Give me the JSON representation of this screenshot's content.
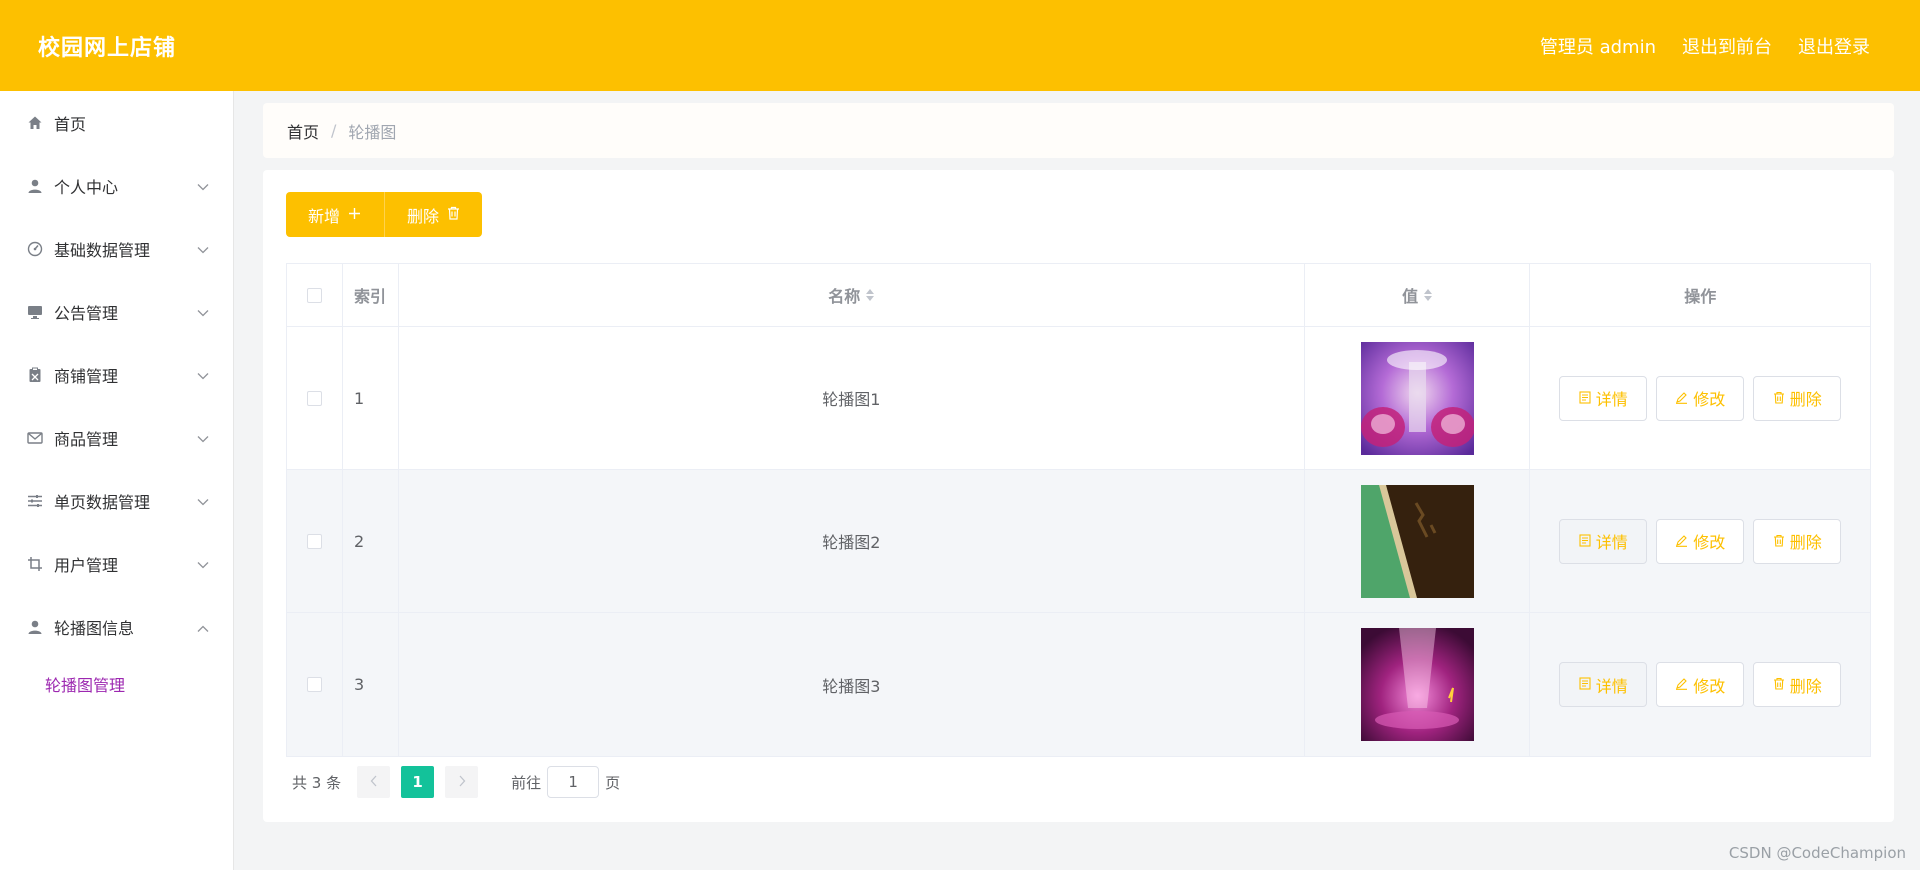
{
  "header": {
    "app_title": "校园网上店铺",
    "admin_label": "管理员 admin",
    "exit_front": "退出到前台",
    "logout": "退出登录"
  },
  "sidebar": {
    "items": [
      {
        "label": "首页",
        "icon": "home-icon",
        "expandable": false
      },
      {
        "label": "个人中心",
        "icon": "user-icon",
        "expandable": true
      },
      {
        "label": "基础数据管理",
        "icon": "gauge-icon",
        "expandable": true
      },
      {
        "label": "公告管理",
        "icon": "monitor-icon",
        "expandable": true
      },
      {
        "label": "商铺管理",
        "icon": "clipboard-icon",
        "expandable": true
      },
      {
        "label": "商品管理",
        "icon": "mail-icon",
        "expandable": true
      },
      {
        "label": "单页数据管理",
        "icon": "sliders-icon",
        "expandable": true
      },
      {
        "label": "用户管理",
        "icon": "crop-icon",
        "expandable": true
      },
      {
        "label": "轮播图信息",
        "icon": "user-icon",
        "expandable": true,
        "expanded": true
      }
    ],
    "sub_items": [
      "轮播图管理"
    ]
  },
  "breadcrumb": {
    "home": "首页",
    "separator": "/",
    "current": "轮播图"
  },
  "toolbar": {
    "add_label": "新增",
    "delete_label": "删除"
  },
  "table": {
    "headers": {
      "index": "索引",
      "name": "名称",
      "value": "值",
      "actions": "操作"
    },
    "rows": [
      {
        "index": "1",
        "name": "轮播图1"
      },
      {
        "index": "2",
        "name": "轮播图2"
      },
      {
        "index": "3",
        "name": "轮播图3"
      }
    ],
    "actions": {
      "detail": "详情",
      "edit": "修改",
      "delete": "删除"
    }
  },
  "pagination": {
    "total_text": "共 3 条",
    "current_page": "1",
    "goto_prefix": "前往",
    "goto_value": "1",
    "goto_suffix": "页"
  },
  "watermark": "CSDN @CodeChampion",
  "colors": {
    "accent": "#fdc000",
    "active_page": "#13c29a",
    "submenu_active": "#9c27b0"
  }
}
